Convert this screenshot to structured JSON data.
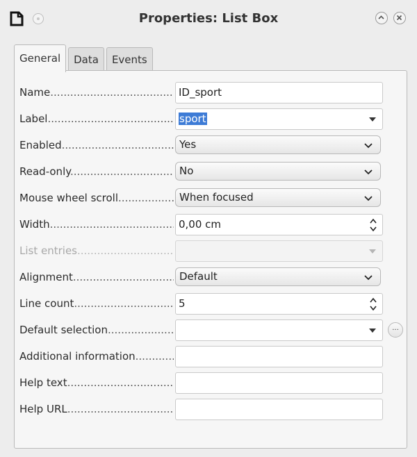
{
  "window": {
    "title": "Properties: List Box"
  },
  "tabs": [
    {
      "label": "General",
      "active": true
    },
    {
      "label": "Data",
      "active": false
    },
    {
      "label": "Events",
      "active": false
    }
  ],
  "dots": "................................................................",
  "rows": [
    {
      "label": "Name",
      "value": "ID_sport",
      "kind": "text"
    },
    {
      "label": "Label",
      "value": "sport",
      "kind": "combo",
      "selected": true
    },
    {
      "label": "Enabled",
      "value": "Yes",
      "kind": "dropdown"
    },
    {
      "label": "Read-only",
      "value": "No",
      "kind": "dropdown"
    },
    {
      "label": "Mouse wheel scroll",
      "value": "When focused",
      "kind": "dropdown"
    },
    {
      "label": "Width",
      "value": "0,00 cm",
      "kind": "spin"
    },
    {
      "label": "List entries",
      "value": "",
      "kind": "combo",
      "disabled": true
    },
    {
      "label": "Alignment",
      "value": "Default",
      "kind": "dropdown"
    },
    {
      "label": "Line count",
      "value": "5",
      "kind": "spin"
    },
    {
      "label": "Default selection",
      "value": "",
      "kind": "combo",
      "has_button": true
    },
    {
      "label": "Additional information",
      "value": "",
      "kind": "text"
    },
    {
      "label": "Help text",
      "value": "",
      "kind": "text"
    },
    {
      "label": "Help URL",
      "value": "",
      "kind": "text"
    }
  ],
  "ellipsis_button_label": "..."
}
